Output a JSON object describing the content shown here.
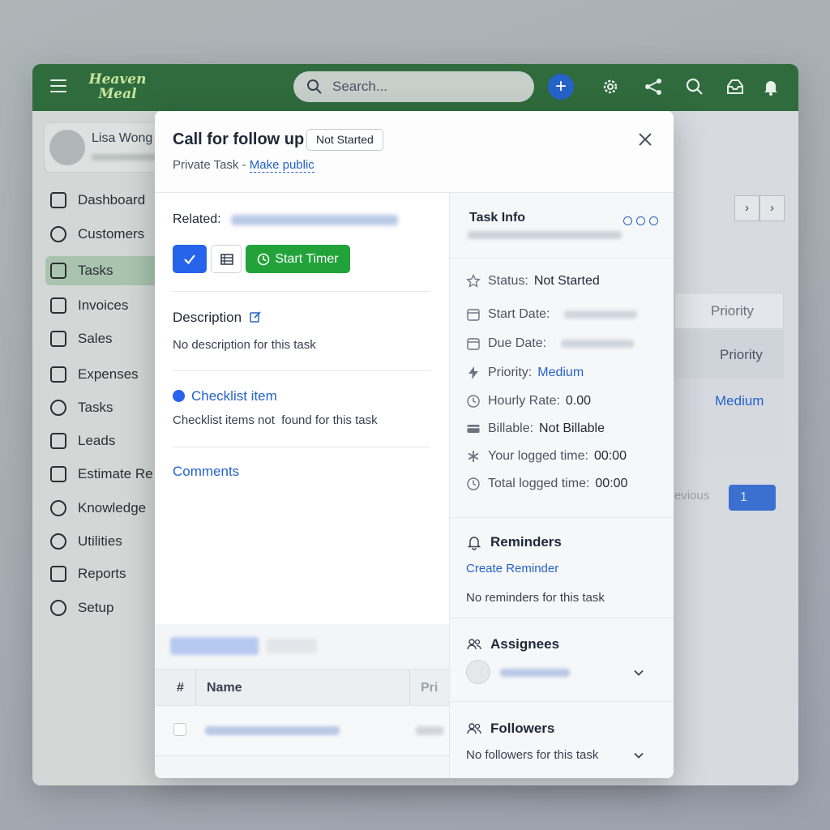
{
  "app": {
    "logo": "Heaven Meal",
    "search_placeholder": "Search...",
    "profile_name": "Lisa Wong",
    "nav": [
      {
        "label": "Dashboard",
        "icon": "dashboard-icon"
      },
      {
        "label": "Customers",
        "icon": "user-icon"
      },
      {
        "label": "Tasks",
        "icon": "file-icon",
        "active": true
      },
      {
        "label": "Invoices",
        "icon": "invoice-icon"
      },
      {
        "label": "Sales",
        "icon": "megaphone-icon"
      },
      {
        "label": "Expenses",
        "icon": "file-icon"
      },
      {
        "label": "Tasks",
        "icon": "clock-icon"
      },
      {
        "label": "Leads",
        "icon": "file-icon"
      },
      {
        "label": "Estimate Re",
        "icon": "file-icon"
      },
      {
        "label": "Knowledge",
        "icon": "circle-icon"
      },
      {
        "label": "Utilities",
        "icon": "gear-icon"
      },
      {
        "label": "Reports",
        "icon": "chart-icon"
      },
      {
        "label": "Setup",
        "icon": "gear-icon"
      }
    ],
    "bg_priority_header": "Priority",
    "bg_priority_col": "Priority",
    "bg_priority_value": "Medium",
    "bg_previous": "evious",
    "bg_page": "1"
  },
  "modal": {
    "title": "Call for follow up",
    "status_badge": "Not Started",
    "private_label": "Private Task - ",
    "make_public": "Make public",
    "related_label": "Related:",
    "start_timer": "Start Timer",
    "description_title": "Description",
    "description_text": "No description for this task",
    "checklist_title": "Checklist item",
    "checklist_text": "Checklist items not  found for this task",
    "comments_title": "Comments",
    "table": {
      "col_hash": "#",
      "col_name": "Name",
      "col_pri": "Pri"
    }
  },
  "task_info": {
    "title": "Task Info",
    "rows": [
      {
        "label": "Status:",
        "value": "Not Started",
        "icon": "star-icon"
      },
      {
        "label": "Start Date:",
        "value": "",
        "icon": "calendar-icon"
      },
      {
        "label": "Due Date:",
        "value": "",
        "icon": "calendar-icon"
      },
      {
        "label": "Priority:",
        "value": "Medium",
        "icon": "bolt-icon"
      },
      {
        "label": "Hourly Rate:",
        "value": "0.00",
        "icon": "clock-icon"
      },
      {
        "label": "Billable:",
        "value": "Not Billable",
        "icon": "card-icon"
      },
      {
        "label": "Your logged time:",
        "value": "00:00",
        "icon": "asterisk-icon"
      },
      {
        "label": "Total logged time:",
        "value": "00:00",
        "icon": "clock-icon"
      }
    ],
    "reminders_title": "Reminders",
    "create_reminder": "Create Reminder",
    "no_reminders": "No reminders for this task",
    "assignees_title": "Assignees",
    "followers_title": "Followers",
    "no_followers": "No followers for this task"
  },
  "colors": {
    "topbar": "#2f6b3d",
    "accent_blue": "#2563eb",
    "timer_green": "#22a33a"
  }
}
